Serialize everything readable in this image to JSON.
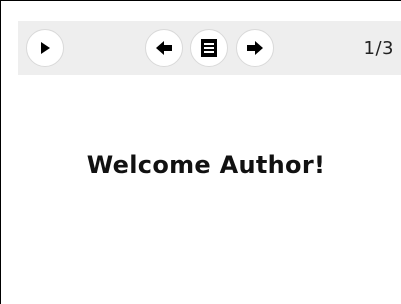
{
  "toolbar": {
    "page_counter": "1/3",
    "icons": {
      "play": "play-icon",
      "previous": "arrow-left-icon",
      "menu": "menu-icon",
      "next": "arrow-right-icon"
    }
  },
  "slide": {
    "title": "Welcome Author!"
  },
  "colors": {
    "toolbar_background": "#eeeeee",
    "button_background": "#ffffff",
    "icon": "#000000",
    "text": "#111111"
  }
}
